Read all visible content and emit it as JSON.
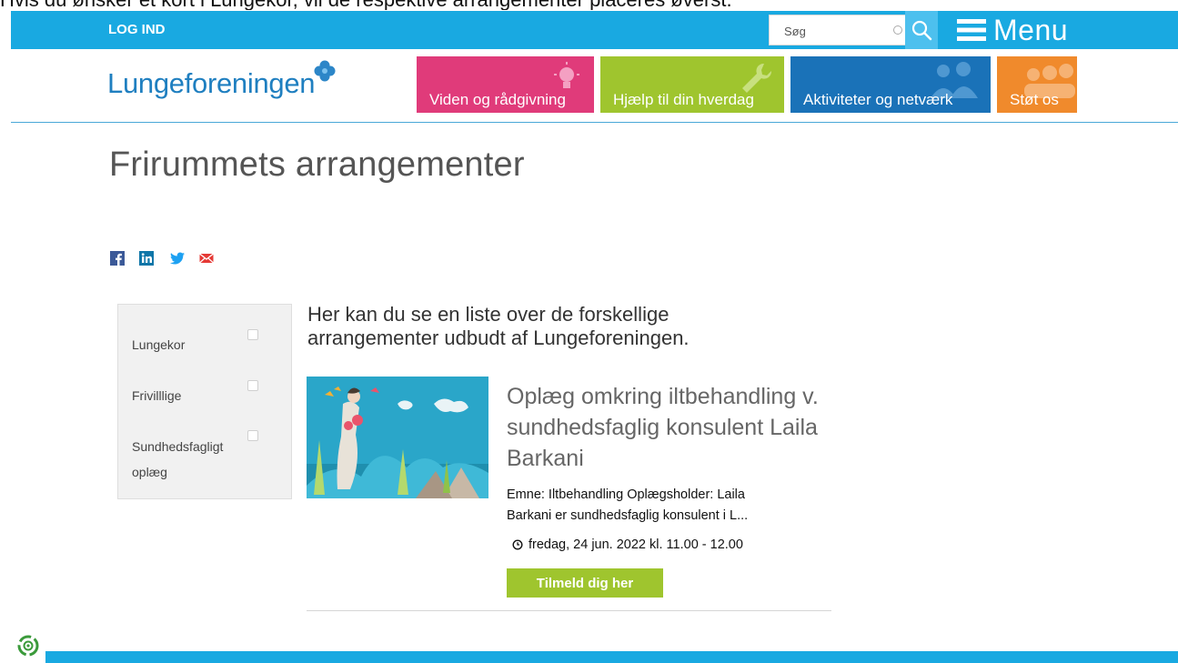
{
  "top_text": "Hvis du ønsker et kort i Lungekor, vil de respektive arrangementer placeres øverst.",
  "topbar": {
    "login_label": "LOG IND",
    "search_placeholder": "Søg",
    "menu_label": "Menu",
    "color": "#19a9e1"
  },
  "logo": {
    "text": "Lungeforeningen",
    "color": "#1f7fc0"
  },
  "nav": [
    {
      "label": "Viden og rådgivning",
      "color": "#e03b7a",
      "icon": "lightbulb-icon"
    },
    {
      "label": "Hjælp til din hverdag",
      "color": "#9fc52e",
      "icon": "wrench-icon"
    },
    {
      "label": "Aktiviteter og netværk",
      "color": "#1a72b8",
      "icon": "people-icon"
    },
    {
      "label": "Støt os",
      "color": "#f08a2c",
      "icon": "group-icon"
    }
  ],
  "page": {
    "title": "Frirummets arrangementer"
  },
  "share": [
    "facebook-icon",
    "linkedin-icon",
    "twitter-icon",
    "email-icon"
  ],
  "filters": [
    {
      "label": "Lungekor"
    },
    {
      "label": "Frivilllige"
    },
    {
      "label_line1": "Sundhedsfagligt",
      "label_line2": "oplæg"
    }
  ],
  "intro": "Her kan du se en liste over de forskellige arrangementer udbudt af Lungeforeningen.",
  "event": {
    "title": "Oplæg omkring iltbehandling v. sundhedsfaglig konsulent Laila Barkani",
    "description": "Emne: Iltbehandling Oplægsholder: Laila Barkani er sundhedsfaglig konsulent i L...",
    "date": "fredag, 24 jun. 2022 kl. 11.00 - 12.00",
    "cta": "Tilmeld dig her",
    "cta_color": "#9fc52e"
  }
}
